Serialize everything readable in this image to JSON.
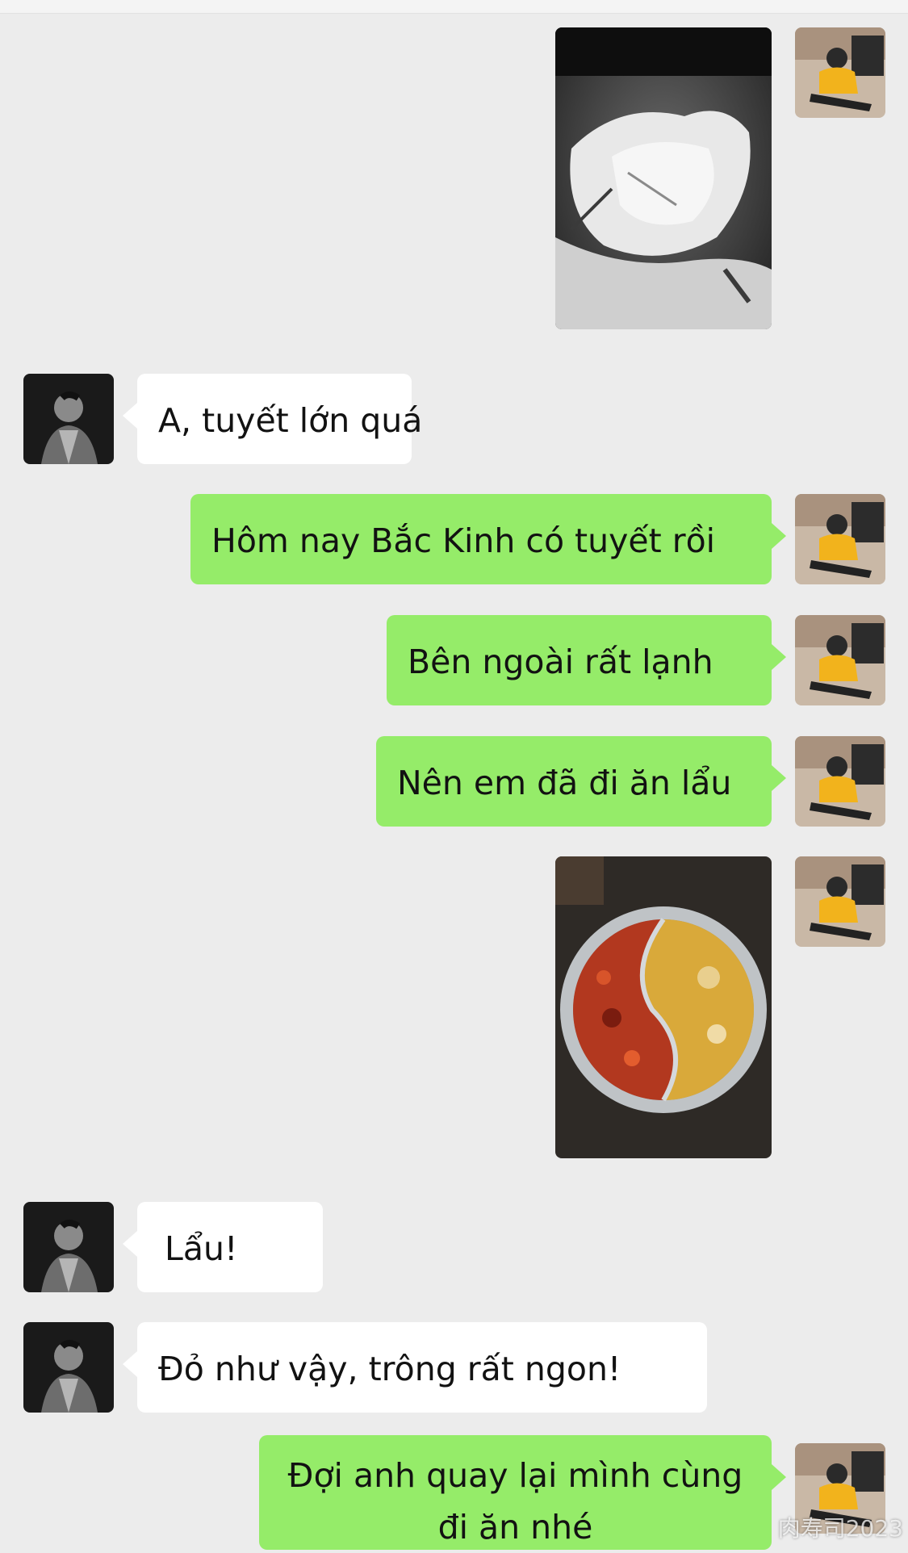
{
  "messages": [
    {
      "type": "image",
      "side": "right",
      "alt": "snow-photo"
    },
    {
      "type": "text",
      "side": "left",
      "text": "A, tuyết lớn quá"
    },
    {
      "type": "text",
      "side": "right",
      "text": "Hôm nay Bắc Kinh có tuyết rồi"
    },
    {
      "type": "text",
      "side": "right",
      "text": "Bên ngoài rất lạnh"
    },
    {
      "type": "text",
      "side": "right",
      "text": "Nên em đã đi ăn lẩu"
    },
    {
      "type": "image",
      "side": "right",
      "alt": "hotpot-photo"
    },
    {
      "type": "text",
      "side": "left",
      "text": "Lẩu!"
    },
    {
      "type": "text",
      "side": "left",
      "text": "Đỏ như vậy, trông rất ngon!"
    },
    {
      "type": "text",
      "side": "right",
      "text": "Đợi anh quay lại mình cùng đi ăn nhé"
    }
  ],
  "watermark": "肉寿司2023",
  "colors": {
    "background": "#ececec",
    "outgoing_bubble": "#95ec69",
    "incoming_bubble": "#ffffff"
  },
  "icons": {
    "left_avatar": "bw-portrait-avatar",
    "right_avatar": "yellow-shirt-avatar"
  }
}
